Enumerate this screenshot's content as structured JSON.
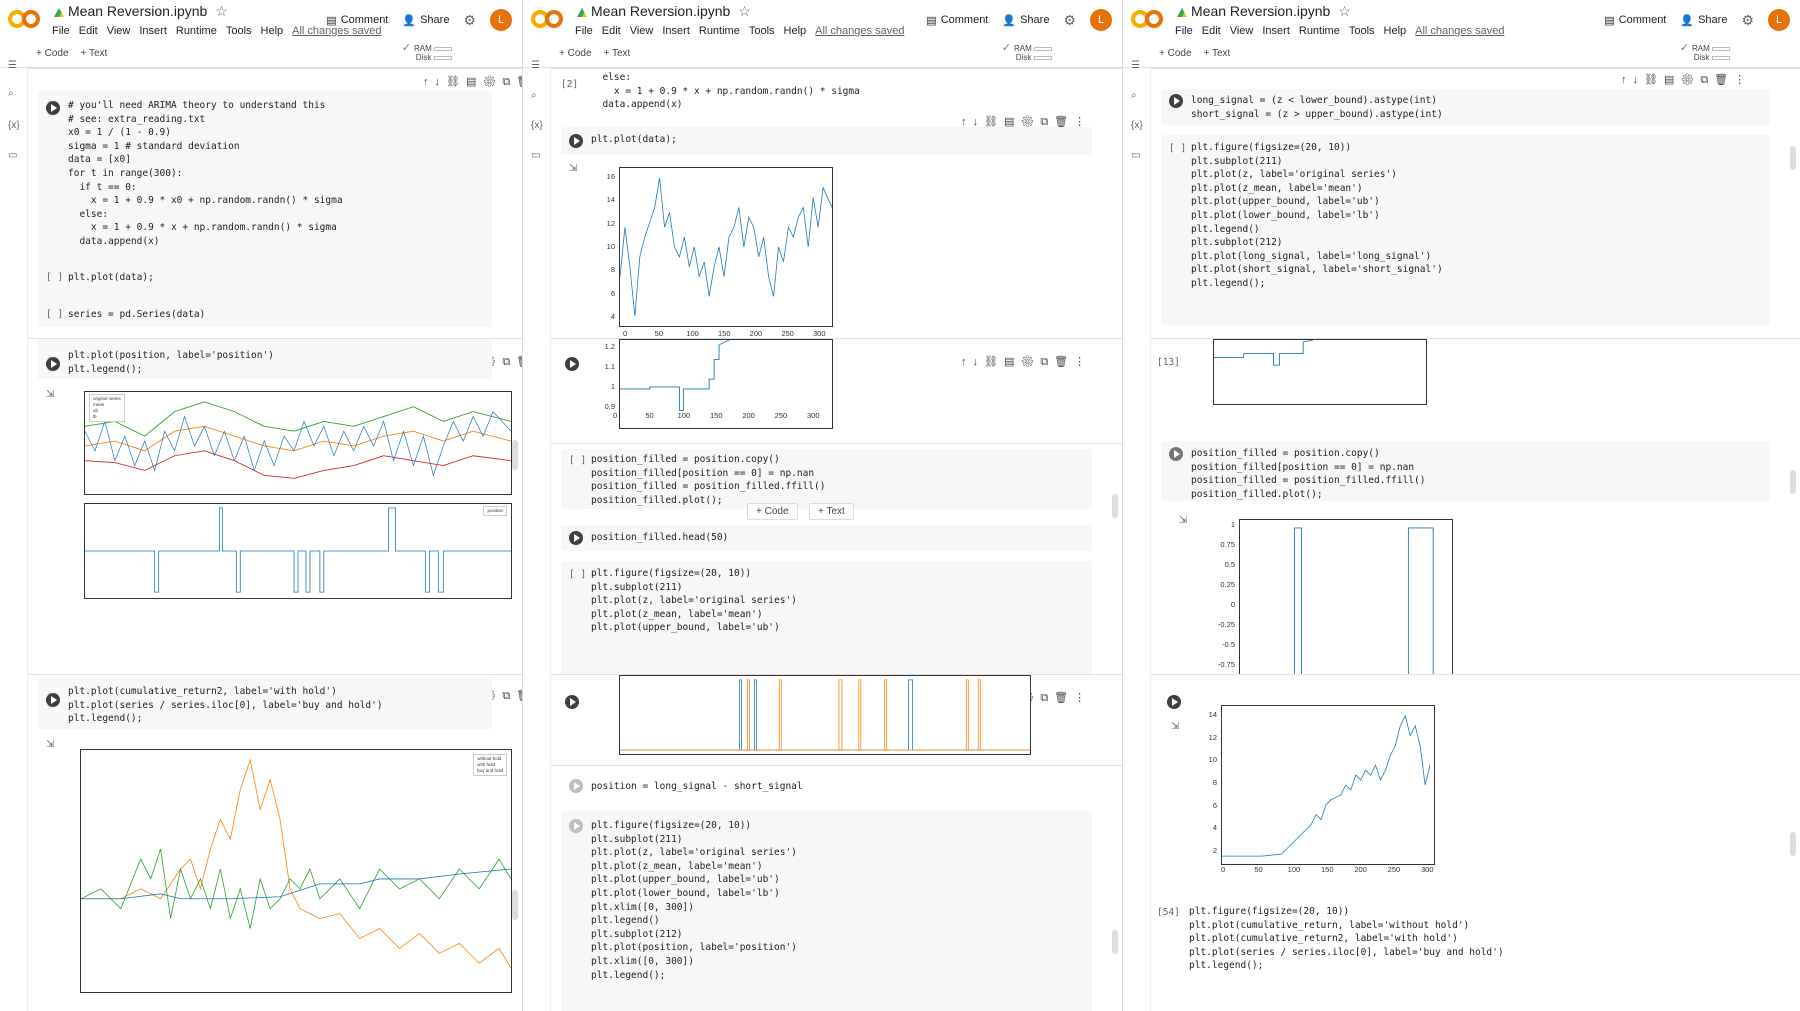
{
  "window": {
    "title": "Mean Reversion.ipynb",
    "menu": [
      "File",
      "Edit",
      "View",
      "Insert",
      "Runtime",
      "Tools",
      "Help"
    ],
    "saved": "All changes saved",
    "comment": "Comment",
    "share": "Share",
    "avatar": "L",
    "add_code": "+ Code",
    "add_text": "+ Text",
    "ram": "RAM",
    "disk": "Disk"
  },
  "cells": {
    "a1_code": "# you'll need ARIMA theory to understand this\n# see: extra_reading.txt\nx0 = 1 / (1 - 0.9)\nsigma = 1 # standard deviation\ndata = [x0]\nfor t in range(300):\n  if t == 0:\n    x = 1 + 0.9 * x0 + np.random.randn() * sigma\n  else:\n    x = 1 + 0.9 * x + np.random.randn() * sigma\n  data.append(x)",
    "a2_code": "plt.plot(data);",
    "a3_code": "series = pd.Series(data)",
    "a4_code": "plt.plot(position, label='position')\nplt.legend();",
    "a5_code": "plt.plot(cumulative_return2, label='with hold')\nplt.plot(series / series.iloc[0], label='buy and hold')\nplt.legend();",
    "b1_code": "  else:\n    x = 1 + 0.9 * x + np.random.randn() * sigma\n  data.append(x)",
    "b2_code": "plt.plot(data);",
    "b3_code": "position_filled = position.copy()\nposition_filled[position == 0] = np.nan\nposition_filled = position_filled.ffill()\nposition_filled.plot();",
    "b4_code": "position_filled.head(50)",
    "b5_code": "plt.figure(figsize=(20, 10))\nplt.subplot(211)\nplt.plot(z, label='original series')\nplt.plot(z_mean, label='mean')\nplt.plot(upper_bound, label='ub')",
    "b6_code": "position = long_signal - short_signal",
    "b7_code": "plt.figure(figsize=(20, 10))\nplt.subplot(211)\nplt.plot(z, label='original series')\nplt.plot(z_mean, label='mean')\nplt.plot(upper_bound, label='ub')\nplt.plot(lower_bound, label='lb')\nplt.xlim([0, 300])\nplt.legend()\nplt.subplot(212)\nplt.plot(position, label='position')\nplt.xlim([0, 300])\nplt.legend();",
    "c1_code": "long_signal = (z < lower_bound).astype(int)\nshort_signal = (z > upper_bound).astype(int)",
    "c2_code": "plt.figure(figsize=(20, 10))\nplt.subplot(211)\nplt.plot(z, label='original series')\nplt.plot(z_mean, label='mean')\nplt.plot(upper_bound, label='ub')\nplt.plot(lower_bound, label='lb')\nplt.legend()\nplt.subplot(212)\nplt.plot(long_signal, label='long_signal')\nplt.plot(short_signal, label='short_signal')\nplt.legend();",
    "c3_code": "position_filled = position.copy()\nposition_filled[position == 0] = np.nan\nposition_filled = position_filled.ffill()\nposition_filled.plot();",
    "c4_code": "plt.figure(figsize=(20, 10))\nplt.plot(cumulative_return, label='without hold')\nplt.plot(cumulative_return2, label='with hold')\nplt.plot(series / series.iloc[0], label='buy and hold')\nplt.legend();"
  },
  "counts": {
    "b_exec2": "[2]",
    "c_exec13": "[13]",
    "c_exec54": "[54]",
    "empty": "[ ]"
  },
  "legends": {
    "z": [
      "original series",
      "mean",
      "ub",
      "lb"
    ],
    "position": [
      "position"
    ],
    "returns": [
      "without hold",
      "with hold",
      "buy and hold"
    ]
  },
  "chart_data": [
    {
      "type": "line",
      "name": "data",
      "x": [
        0,
        50,
        100,
        150,
        200,
        250,
        300
      ],
      "yticks": [
        4,
        6,
        8,
        10,
        12,
        14,
        16
      ],
      "ylim": [
        4,
        17
      ]
    },
    {
      "type": "line",
      "name": "position_filled",
      "yticks": [
        0.9,
        1.0,
        1.1,
        1.2
      ],
      "xticks": [
        0,
        50,
        100,
        150,
        200,
        250,
        300
      ]
    },
    {
      "type": "line",
      "name": "position_filled_c",
      "yticks": [
        -0.75,
        -0.5,
        -0.25,
        0.0,
        0.25,
        0.5,
        0.75,
        1.0
      ]
    },
    {
      "type": "line",
      "name": "series",
      "yticks": [
        2,
        4,
        6,
        8,
        10,
        12,
        14
      ],
      "xticks": [
        0,
        50,
        100,
        150,
        200,
        250,
        300
      ]
    }
  ],
  "colors": {
    "blue": "#1f77b4",
    "orange": "#ff7f0e",
    "green": "#2ca02c",
    "red": "#d62728",
    "accent": "#e8710a"
  }
}
